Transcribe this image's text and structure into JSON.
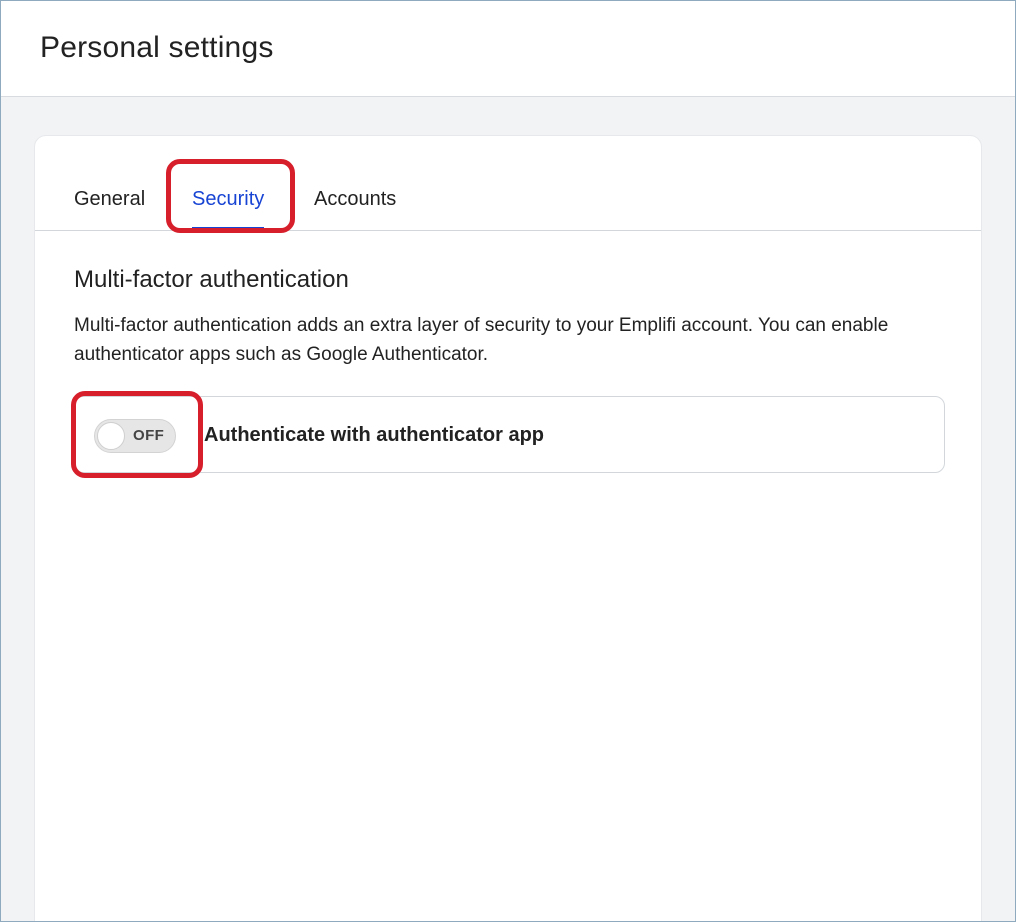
{
  "header": {
    "title": "Personal settings"
  },
  "tabs": [
    {
      "label": "General",
      "active": false
    },
    {
      "label": "Security",
      "active": true
    },
    {
      "label": "Accounts",
      "active": false
    }
  ],
  "mfa": {
    "title": "Multi-factor authentication",
    "description": "Multi-factor authentication adds an extra layer of security to your Emplifi account. You can enable authenticator apps such as Google Authenticator.",
    "option": {
      "toggle_state": "OFF",
      "label": "Authenticate with authenticator app"
    }
  },
  "colors": {
    "active_tab": "#1844d4",
    "highlight": "#d71f2b",
    "background": "#f2f3f5"
  }
}
